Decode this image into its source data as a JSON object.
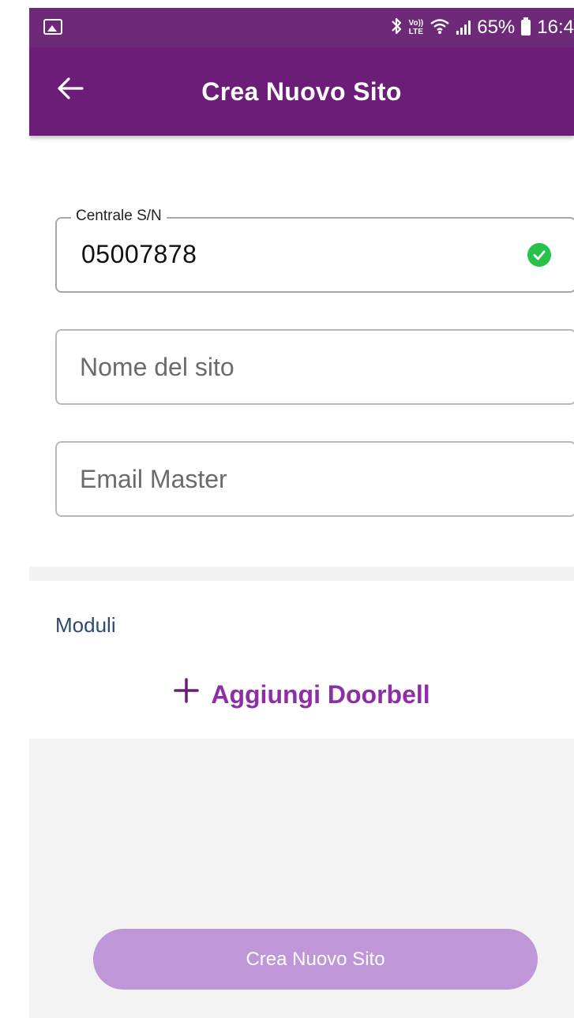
{
  "status_bar": {
    "battery_percent": "65%",
    "time": "16:4",
    "volte_top": "Vo))",
    "volte_bottom": "LTE",
    "icons": [
      "gallery-icon",
      "bluetooth-icon",
      "volte-icon",
      "wifi-icon",
      "signal-icon",
      "battery-icon"
    ]
  },
  "app_bar": {
    "title": "Crea Nuovo Sito",
    "back_icon": "arrow-left-icon",
    "color": "#6c1d77"
  },
  "form": {
    "serial": {
      "label": "Centrale S/N",
      "value": "05007878",
      "status_icon": "check-circle-icon",
      "status_color": "#27c24c"
    },
    "site_name": {
      "value": "",
      "placeholder": "Nome del sito"
    },
    "email_master": {
      "value": "",
      "placeholder": "Email Master"
    }
  },
  "modules": {
    "heading": "Moduli",
    "add_label": "Aggiungi Doorbell",
    "add_icon": "plus-icon",
    "accent_color": "#8e2ea6"
  },
  "footer": {
    "create_label": "Crea Nuovo Sito",
    "button_color": "#bf97d8"
  }
}
